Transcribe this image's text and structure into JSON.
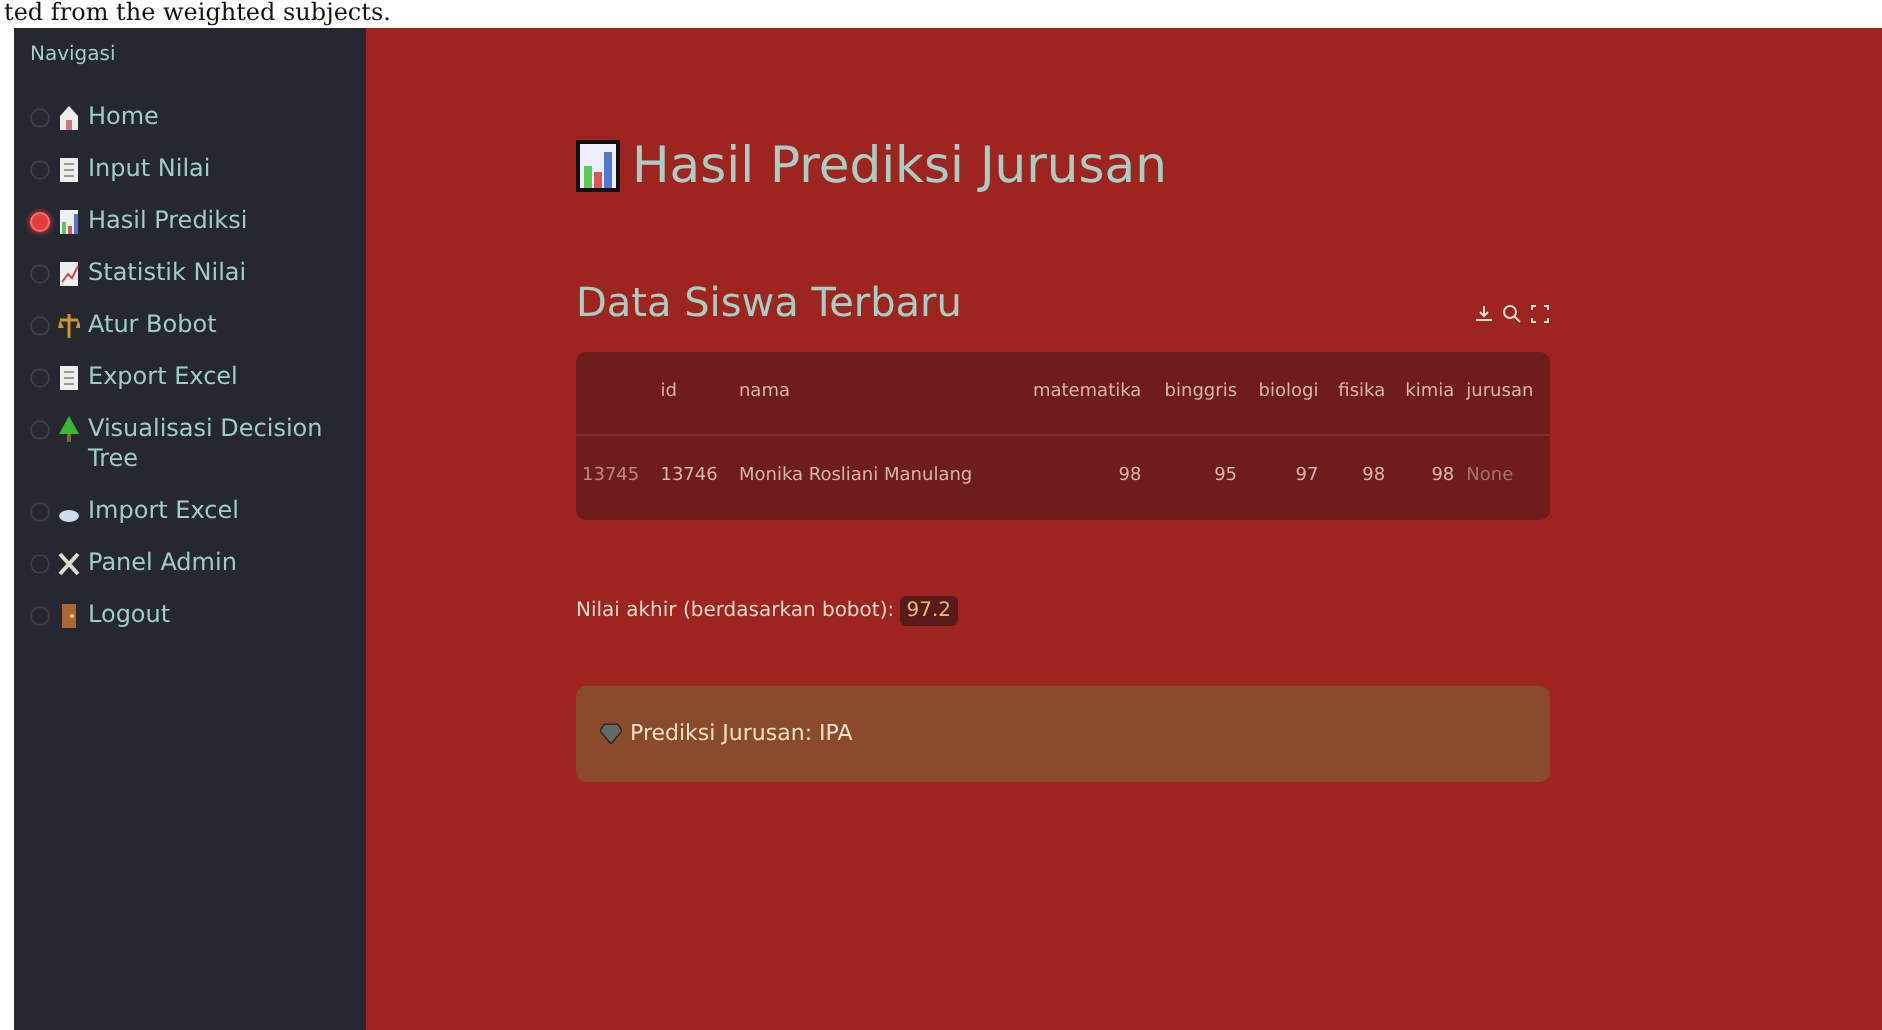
{
  "caption_fragment": "ted from the weighted subjects.",
  "sidebar": {
    "title": "Navigasi",
    "items": [
      {
        "label": "Home",
        "selected": false
      },
      {
        "label": "Input Nilai",
        "selected": false
      },
      {
        "label": "Hasil Prediksi",
        "selected": true
      },
      {
        "label": "Statistik Nilai",
        "selected": false
      },
      {
        "label": "Atur Bobot",
        "selected": false
      },
      {
        "label": "Export Excel",
        "selected": false
      },
      {
        "label": "Visualisasi Decision Tree",
        "selected": false
      },
      {
        "label": "Import Excel",
        "selected": false
      },
      {
        "label": "Panel Admin",
        "selected": false
      },
      {
        "label": "Logout",
        "selected": false
      }
    ]
  },
  "page_title": "Hasil Prediksi Jurusan",
  "section_title": "Data Siswa Terbaru",
  "table": {
    "columns": [
      "",
      "id",
      "nama",
      "matematika",
      "binggris",
      "biologi",
      "fisika",
      "kimia",
      "jurusan"
    ],
    "rows": [
      [
        "13745",
        "13746",
        "Monika Rosliani Manulang",
        "98",
        "95",
        "97",
        "98",
        "98",
        "None"
      ]
    ]
  },
  "final_score": {
    "label": "Nilai akhir (berdasarkan bobot):",
    "value": "97.2"
  },
  "prediction": {
    "text": "Prediksi Jurusan: IPA"
  }
}
